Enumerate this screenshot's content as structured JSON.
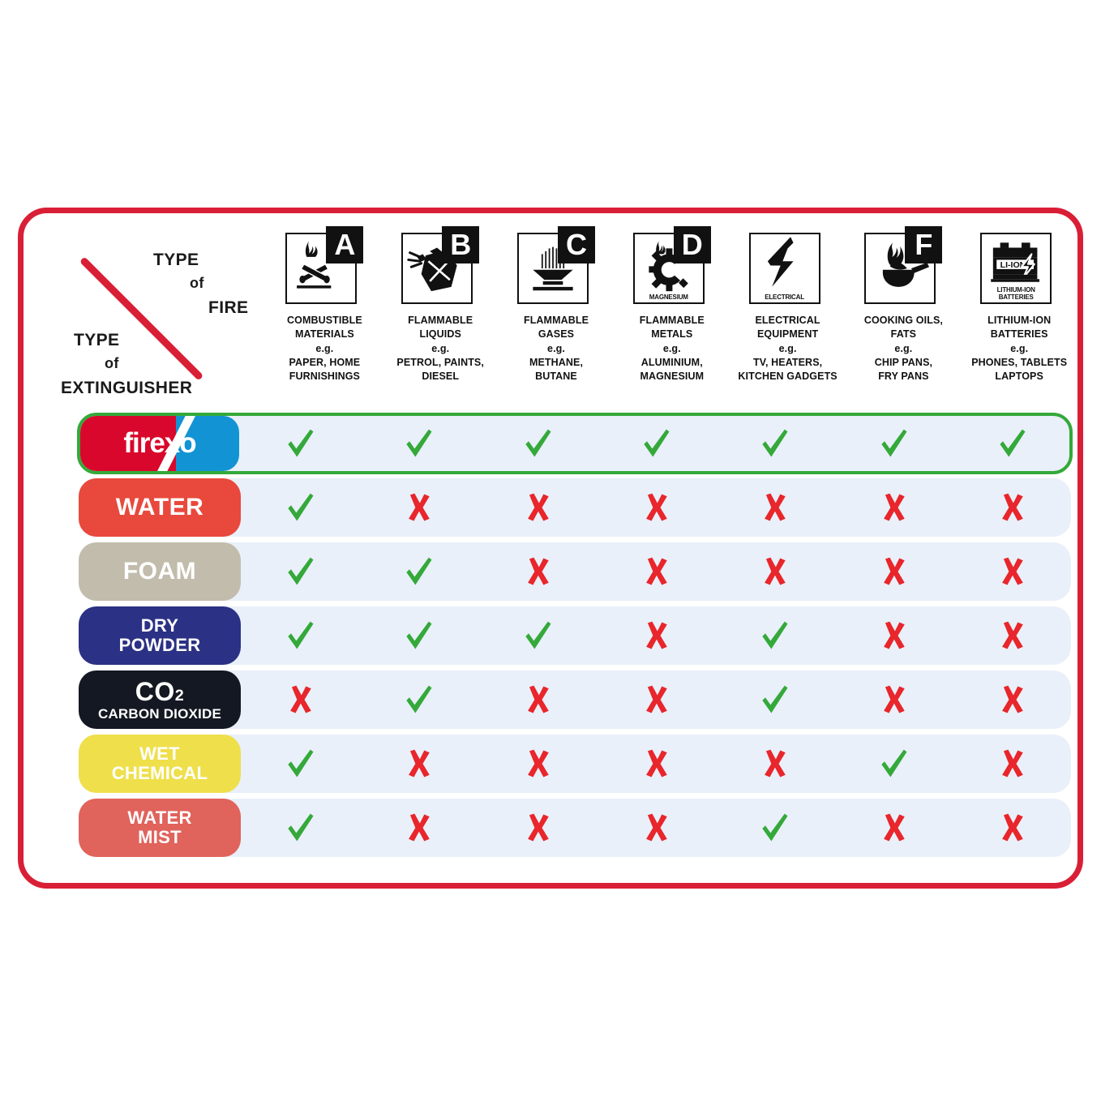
{
  "corner": {
    "fire_line1": "TYPE",
    "fire_line2": "of",
    "fire_line3": "FIRE",
    "ext_line1": "TYPE",
    "ext_line2": "of",
    "ext_line3": "EXTINGUISHER"
  },
  "colors": {
    "frame_border": "#D91F36",
    "row_background": "#E9F0F9",
    "check_green": "#34A93A",
    "cross_red": "#E8262B",
    "firexo_outline": "#34A93A"
  },
  "columns": [
    {
      "letter": "A",
      "icon": "burning-logs-icon",
      "icon_caption": "",
      "description": "COMBUSTIBLE\nMATERIALS\ne.g.\nPAPER, HOME\nFURNISHINGS"
    },
    {
      "letter": "B",
      "icon": "fuel-can-icon",
      "icon_caption": "",
      "description": "FLAMMABLE\nLIQUIDS\ne.g.\nPETROL, PAINTS,\nDIESEL"
    },
    {
      "letter": "C",
      "icon": "gas-burner-icon",
      "icon_caption": "",
      "description": "FLAMMABLE\nGASES\ne.g.\nMETHANE,\nBUTANE"
    },
    {
      "letter": "D",
      "icon": "burning-gear-icon",
      "icon_caption": "MAGNESIUM",
      "description": "FLAMMABLE\nMETALS\ne.g.\nALUMINIUM,\nMAGNESIUM"
    },
    {
      "letter": "",
      "icon": "lightning-bolt-icon",
      "icon_caption": "ELECTRICAL",
      "description": "ELECTRICAL\nEQUIPMENT\ne.g.\nTV, HEATERS,\nKITCHEN GADGETS"
    },
    {
      "letter": "F",
      "icon": "burning-pan-icon",
      "icon_caption": "",
      "description": "COOKING OILS,\nFATS\ne.g.\nCHIP PANS,\nFRY PANS"
    },
    {
      "letter": "",
      "icon": "lithium-battery-icon",
      "icon_caption": "LITHIUM-ION\nBATTERIES",
      "description": "LITHIUM-ION\nBATTERIES\ne.g.\nPHONES, TABLETS\nLAPTOPS"
    }
  ],
  "rows": [
    {
      "id": "firexo",
      "label": "firexo",
      "label2": "",
      "label_color": "#D9072B",
      "text_color": "#FFFFFF",
      "results": [
        "check",
        "check",
        "check",
        "check",
        "check",
        "check",
        "check"
      ]
    },
    {
      "id": "water",
      "label": "WATER",
      "label2": "",
      "label_color": "#E8493C",
      "text_color": "#FFFFFF",
      "results": [
        "check",
        "cross",
        "cross",
        "cross",
        "cross",
        "cross",
        "cross"
      ]
    },
    {
      "id": "foam",
      "label": "FOAM",
      "label2": "",
      "label_color": "#C2BCAC",
      "text_color": "#FFFFFF",
      "results": [
        "check",
        "check",
        "cross",
        "cross",
        "cross",
        "cross",
        "cross"
      ]
    },
    {
      "id": "dry-powder",
      "label": "DRY",
      "label2": "POWDER",
      "label_color": "#2B3184",
      "text_color": "#FFFFFF",
      "results": [
        "check",
        "check",
        "check",
        "cross",
        "check",
        "cross",
        "cross"
      ]
    },
    {
      "id": "co2",
      "label": "CO2",
      "label2": "CARBON DIOXIDE",
      "label_color": "#131822",
      "text_color": "#FFFFFF",
      "results": [
        "cross",
        "check",
        "cross",
        "cross",
        "check",
        "cross",
        "cross"
      ]
    },
    {
      "id": "wet-chemical",
      "label": "WET",
      "label2": "CHEMICAL",
      "label_color": "#EFDF4B",
      "text_color": "#FFFFFF",
      "results": [
        "check",
        "cross",
        "cross",
        "cross",
        "cross",
        "check",
        "cross"
      ]
    },
    {
      "id": "water-mist",
      "label": "WATER",
      "label2": "MIST",
      "label_color": "#E0635C",
      "text_color": "#FFFFFF",
      "results": [
        "check",
        "cross",
        "cross",
        "cross",
        "check",
        "cross",
        "cross"
      ]
    }
  ]
}
